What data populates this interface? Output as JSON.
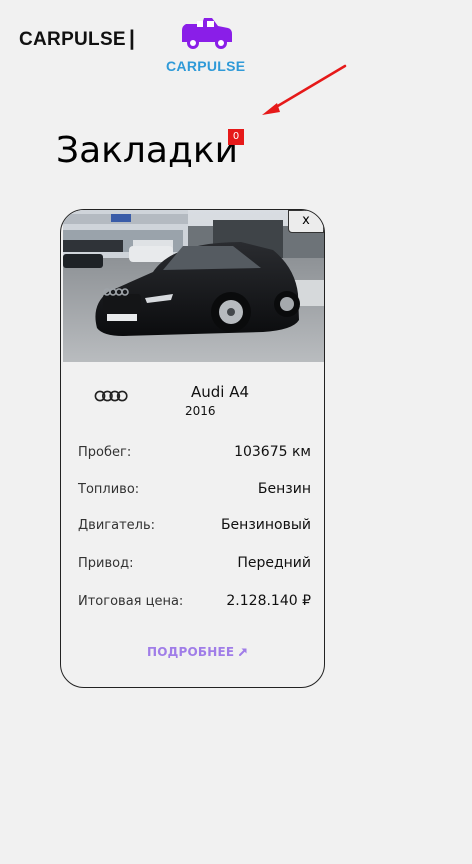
{
  "header": {
    "brand": "CARPULSE",
    "separator": "|",
    "logo_text": "CARPULSE"
  },
  "page": {
    "title": "Закладки",
    "bookmark_count": "0"
  },
  "card": {
    "close_label": "x",
    "make_icon": "audi-rings-icon",
    "model": "Audi A4",
    "year": "2016",
    "specs": [
      {
        "label": "Пробег:",
        "value": "103675 км"
      },
      {
        "label": "Топливо:",
        "value": "Бензин"
      },
      {
        "label": "Двигатель:",
        "value": "Бензиновый"
      },
      {
        "label": "Привод:",
        "value": "Передний"
      },
      {
        "label": "Итоговая цена:",
        "value": "2.128.140 ₽"
      }
    ],
    "more_label": "ПОДРОБНЕЕ"
  },
  "colors": {
    "background": "#f1f1f1",
    "logo_car": "#8a1ee8",
    "logo_text": "#2f9ad8",
    "badge": "#e61919",
    "arrow": "#e61919",
    "link": "#a07de8"
  }
}
